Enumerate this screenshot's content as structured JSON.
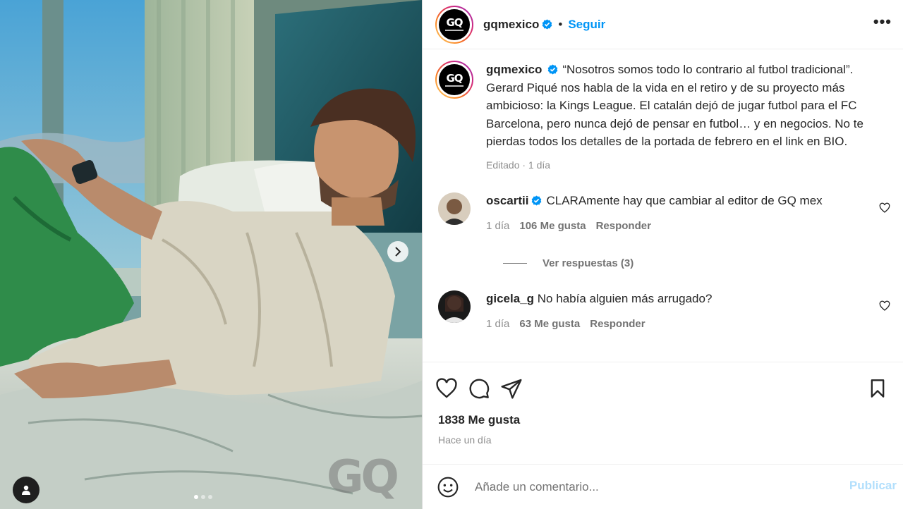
{
  "post": {
    "username": "gqmexico",
    "follow_label": "Seguir",
    "separator": "•",
    "more_label": "•••",
    "caption": "“Nosotros somos todo lo contrario al futbol tradicional”. Gerard Piqué nos habla de la vida en el retiro y de su proyecto más ambicioso: la Kings League. El catalán dejó de jugar futbol para el FC Barcelona, pero nunca dejó de pensar en futbol… y en negocios. No te pierdas todos los detalles de la portada de febrero en el link en BIO.",
    "caption_meta": "Editado · 1 día",
    "watermark": "GQ",
    "logo_text": "GQ"
  },
  "comments": [
    {
      "username": "oscartii",
      "verified": true,
      "text": "CLARAmente hay que cambiar al editor de GQ mex",
      "time": "1 día",
      "likes": "106 Me gusta",
      "reply_label": "Responder",
      "view_replies": "Ver respuestas (3)"
    },
    {
      "username": "gicela_g",
      "verified": false,
      "text": "No había alguien más arrugado?",
      "time": "1 día",
      "likes": "63 Me gusta",
      "reply_label": "Responder"
    }
  ],
  "stats": {
    "likes": "1838 Me gusta",
    "time_ago": "Hace un día"
  },
  "composer": {
    "placeholder": "Añade un comentario...",
    "publish_label": "Publicar"
  },
  "carousel": {
    "slide_count": 3,
    "active_index": 0
  },
  "colors": {
    "accent": "#0095f6",
    "publish_disabled": "#b2dffc",
    "verified": "#0095f6"
  },
  "icons": [
    "heart-icon",
    "comment-icon",
    "share-icon",
    "bookmark-icon",
    "emoji-icon",
    "chevron-right-icon",
    "user-tag-icon",
    "more-icon",
    "verified-icon"
  ]
}
